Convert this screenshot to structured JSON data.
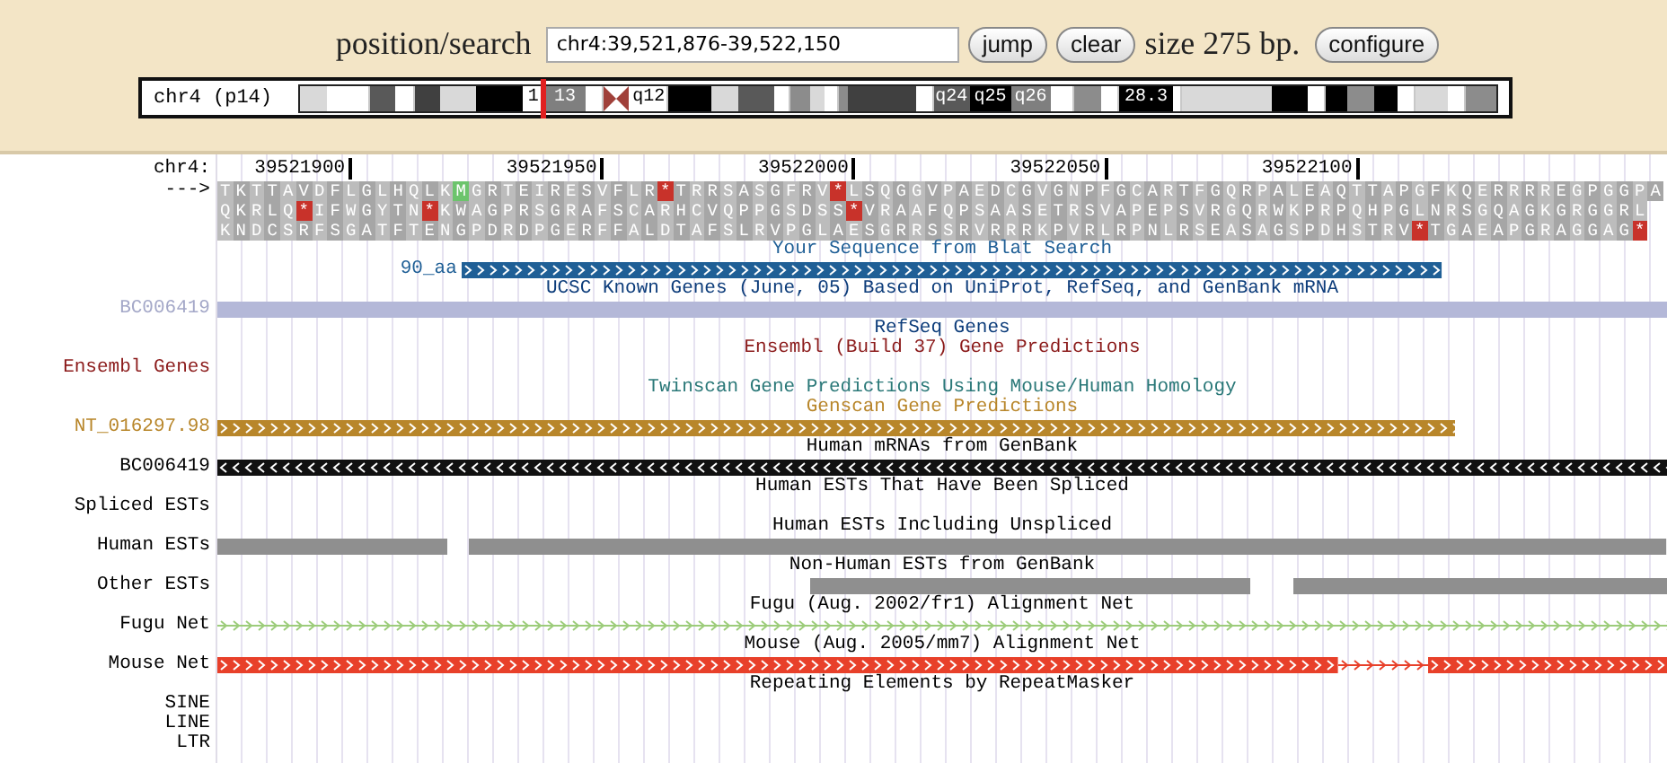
{
  "position_search": {
    "label": "position/search",
    "value": "chr4:39,521,876-39,522,150"
  },
  "buttons": [
    "jump",
    "clear"
  ],
  "size_text": "size 275 bp.",
  "configure_button": "configure",
  "ideogram": {
    "label": "chr4 (p14)",
    "bands": [
      {
        "color": "#d9d9d9",
        "current": false
      },
      {
        "color": "#ffffff",
        "current": false
      },
      {
        "color": "#595959",
        "current": false
      },
      {
        "color": "#ffffff",
        "current": false
      },
      {
        "color": "#404040",
        "current": false
      },
      {
        "color": "#d9d9d9",
        "current": false
      },
      {
        "color": "#000000",
        "current": false
      },
      {
        "color": "#ffffff",
        "label": "1",
        "current": false
      },
      {
        "color": "#e02020",
        "kind": "marker",
        "current": true
      },
      {
        "color": "#7f7f7f",
        "label": "13",
        "current": false
      },
      {
        "color": "#ffffff",
        "current": false
      },
      {
        "color": "#a0403a",
        "kind": "centromere",
        "current": false
      },
      {
        "color": "#ffffff",
        "label": "q12",
        "current": false
      },
      {
        "color": "#000000",
        "current": false
      },
      {
        "color": "#d9d9d9",
        "current": false
      },
      {
        "color": "#595959",
        "current": false
      },
      {
        "color": "#ffffff",
        "current": false
      },
      {
        "color": "#8c8c8c",
        "current": false
      },
      {
        "color": "#d9d9d9",
        "current": false
      },
      {
        "color": "#ffffff",
        "current": false
      },
      {
        "color": "#8c8c8c",
        "current": false
      },
      {
        "color": "#404040",
        "current": false
      },
      {
        "color": "#ffffff",
        "current": false
      },
      {
        "color": "#595959",
        "label": "q24",
        "current": false
      },
      {
        "color": "#000000",
        "label": "q25",
        "current": false
      },
      {
        "color": "#7f7f7f",
        "label": "q26",
        "current": false
      },
      {
        "color": "#ffffff",
        "current": false
      },
      {
        "color": "#8c8c8c",
        "current": false
      },
      {
        "color": "#ffffff",
        "current": false
      },
      {
        "color": "#000000",
        "label": "28.3",
        "current": false
      },
      {
        "color": "#ffffff",
        "current": false
      },
      {
        "color": "#d9d9d9",
        "current": false
      },
      {
        "color": "#000000",
        "current": false
      },
      {
        "color": "#ffffff",
        "current": false
      },
      {
        "color": "#000000",
        "current": false
      },
      {
        "color": "#8c8c8c",
        "current": false
      },
      {
        "color": "#000000",
        "current": false
      },
      {
        "color": "#ffffff",
        "current": false
      },
      {
        "color": "#d9d9d9",
        "current": false
      },
      {
        "color": "#ffffff",
        "current": false
      },
      {
        "color": "#8c8c8c",
        "current": false
      }
    ]
  },
  "ruler": {
    "label": "chr4:",
    "ticks": [
      "39521900",
      "39521950",
      "39522000",
      "39522050",
      "39522100"
    ]
  },
  "translation": {
    "strand_label": "--->",
    "frames": [
      {
        "parts": [
          {
            "kind": "residues",
            "text": "TKTTAVDFLGLHQLK"
          },
          {
            "kind": "start",
            "text": "M"
          },
          {
            "kind": "residues",
            "text": "GRTEIRESVFLR"
          },
          {
            "kind": "stop",
            "text": "*"
          },
          {
            "kind": "residues",
            "text": "TRRSASGFRV"
          },
          {
            "kind": "stop",
            "text": "*"
          },
          {
            "kind": "residues",
            "text": "LSQGGVPAEDCGVGNPFGCARTFGQRPALEAQTTAPGFKQERRRREGPGGPA"
          }
        ]
      },
      {
        "parts": [
          {
            "kind": "residues",
            "text": "QKRLQ"
          },
          {
            "kind": "stop",
            "text": "*"
          },
          {
            "kind": "residues",
            "text": "IFWGYTN"
          },
          {
            "kind": "stop",
            "text": "*"
          },
          {
            "kind": "residues",
            "text": "KWAGPRSGRAFSCARHCVQPPGSDSS"
          },
          {
            "kind": "stop",
            "text": "*"
          },
          {
            "kind": "residues",
            "text": "VRAAFQPSAASETRSVAPEPSVRGQRWKPRPQHPGLNRSGQAGKGRGGRL"
          }
        ]
      },
      {
        "parts": [
          {
            "kind": "residues",
            "text": "KNDCSRFSGATFTENGPDRDPGERFFALDTAFSLRVPGLAESGRRSSRVRRRKPVRLRPNLRSEASAGSPDHSTRV"
          },
          {
            "kind": "stop",
            "text": "*"
          },
          {
            "kind": "residues",
            "text": "TGAEAPGRAGGAG"
          },
          {
            "kind": "stop",
            "text": "*"
          }
        ]
      }
    ]
  },
  "tracks": [
    {
      "title": "Your Sequence from Blat Search",
      "color": "#1f5f96",
      "rows": [
        {
          "feature_label": "90_aa",
          "kind": "forward",
          "color": "#1f5f96"
        }
      ]
    },
    {
      "title": "UCSC Known Genes (June, 05) Based on UniProt, RefSeq, and GenBank mRNA",
      "color": "#0c3c7a",
      "rows": [
        {
          "label": {
            "text": "BC006419",
            "color": "#a4a8c8"
          },
          "kind": "solid",
          "color": "#b4b8d8"
        }
      ]
    },
    {
      "title": "RefSeq Genes",
      "color": "#0c3c7a"
    },
    {
      "title": "Ensembl (Build 37) Gene Predictions",
      "color": "#8b1a1a",
      "rows": [
        {
          "label": {
            "text": "Ensembl Genes",
            "color": "#8b1a1a"
          },
          "kind": "empty"
        }
      ]
    },
    {
      "title": "Twinscan Gene Predictions Using Mouse/Human Homology",
      "color": "#2a7878"
    },
    {
      "title": "Genscan Gene Predictions",
      "color": "#b8862a",
      "rows": [
        {
          "label": {
            "text": "NT_016297.98",
            "color": "#b8862a"
          },
          "kind": "forward",
          "color": "#b8862a"
        }
      ]
    },
    {
      "title": "Human mRNAs from GenBank",
      "color": "#000000",
      "rows": [
        {
          "label": {
            "text": "BC006419"
          },
          "kind": "reverse",
          "color": "#111111"
        }
      ]
    },
    {
      "title": "Human ESTs That Have Been Spliced",
      "color": "#000000",
      "rows": [
        {
          "label": {
            "text": "Spliced ESTs"
          },
          "kind": "empty"
        }
      ]
    },
    {
      "title": "Human ESTs Including Unspliced",
      "color": "#000000",
      "rows": [
        {
          "label": {
            "text": "Human ESTs"
          },
          "kind": "solid",
          "color": "#8f8f8f"
        }
      ]
    },
    {
      "title": "Non-Human ESTs from GenBank",
      "color": "#000000",
      "rows": [
        {
          "label": {
            "text": "Other ESTs"
          },
          "kind": "solid",
          "color": "#8f8f8f"
        }
      ]
    },
    {
      "title": "Fugu (Aug. 2002/fr1) Alignment Net",
      "color": "#000000",
      "rows": [
        {
          "label": {
            "text": "Fugu Net"
          },
          "kind": "line",
          "color": "#9ccc7a"
        }
      ]
    },
    {
      "title": "Mouse (Aug. 2005/mm7) Alignment Net",
      "color": "#000000",
      "rows": [
        {
          "label": {
            "text": "Mouse Net"
          },
          "kind": "forward",
          "color": "#e8402a"
        }
      ]
    },
    {
      "title": "Repeating Elements by RepeatMasker",
      "color": "#000000",
      "rows": [
        {
          "label": {
            "text": "SINE"
          },
          "kind": "empty"
        },
        {
          "label": {
            "text": "LINE"
          },
          "kind": "empty"
        },
        {
          "label": {
            "text": "LTR"
          },
          "kind": "empty"
        }
      ]
    }
  ]
}
